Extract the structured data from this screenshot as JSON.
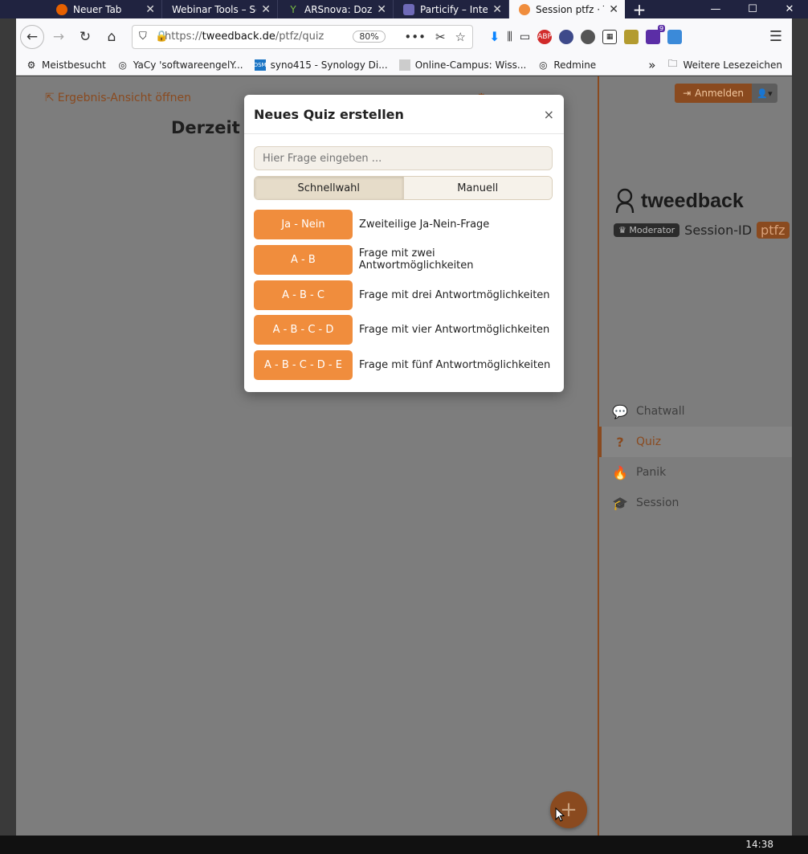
{
  "browser": {
    "tabs": [
      {
        "title": "Neuer Tab",
        "active": false
      },
      {
        "title": "Webinar Tools – Sof",
        "active": false
      },
      {
        "title": "ARSnova: Dozen",
        "active": false
      },
      {
        "title": "Particify – Intera",
        "active": false
      },
      {
        "title": "Session ptfz · Tw",
        "active": true
      }
    ],
    "url_prefix": "https://",
    "url_host": "tweedback.de",
    "url_path": "/ptfz/quiz",
    "zoom": "80%",
    "ext_badge": "9",
    "bookmarks": [
      {
        "label": "Meistbesucht",
        "icon": "gear-icon"
      },
      {
        "label": "YaCy 'softwareengelY...",
        "icon": "globe-icon"
      },
      {
        "label": "syno415 - Synology Di...",
        "icon": "dsm-icon"
      },
      {
        "label": "Online-Campus: Wiss...",
        "icon": "page-icon"
      },
      {
        "label": "Redmine",
        "icon": "globe-icon"
      }
    ],
    "bookmarks_more": "Weitere Lesezeichen"
  },
  "page": {
    "result_link": "Ergebnis-Ansicht öffnen",
    "headline": "Derzeit is",
    "login_label": "Anmelden",
    "brand_name": "tweedback",
    "moderator_badge": "Moderator",
    "session_id_label": "Session-ID",
    "session_id_value": "ptfz",
    "nav": [
      {
        "label": "Chatwall",
        "icon": "chat-icon",
        "active": false
      },
      {
        "label": "Quiz",
        "icon": "question-icon",
        "active": true
      },
      {
        "label": "Panik",
        "icon": "fire-icon",
        "active": false
      },
      {
        "label": "Session",
        "icon": "graduation-cap-icon",
        "active": false
      }
    ],
    "accent_color": "#f08d3d"
  },
  "modal": {
    "title": "Neues Quiz erstellen",
    "close": "×",
    "question_placeholder": "Hier Frage eingeben ...",
    "segments": [
      {
        "label": "Schnellwahl",
        "selected": true
      },
      {
        "label": "Manuell",
        "selected": false
      }
    ],
    "options": [
      {
        "button": "Ja - Nein",
        "description": "Zweiteilige Ja-Nein-Frage"
      },
      {
        "button": "A - B",
        "description": "Frage mit zwei Antwortmöglichkeiten"
      },
      {
        "button": "A - B - C",
        "description": "Frage mit drei Antwortmöglichkeiten"
      },
      {
        "button": "A - B - C - D",
        "description": "Frage mit vier Antwortmöglichkeiten"
      },
      {
        "button": "A - B - C - D - E",
        "description": "Frage mit fünf Antwortmöglichkeiten"
      }
    ]
  },
  "taskbar": {
    "clock": "14:38"
  }
}
